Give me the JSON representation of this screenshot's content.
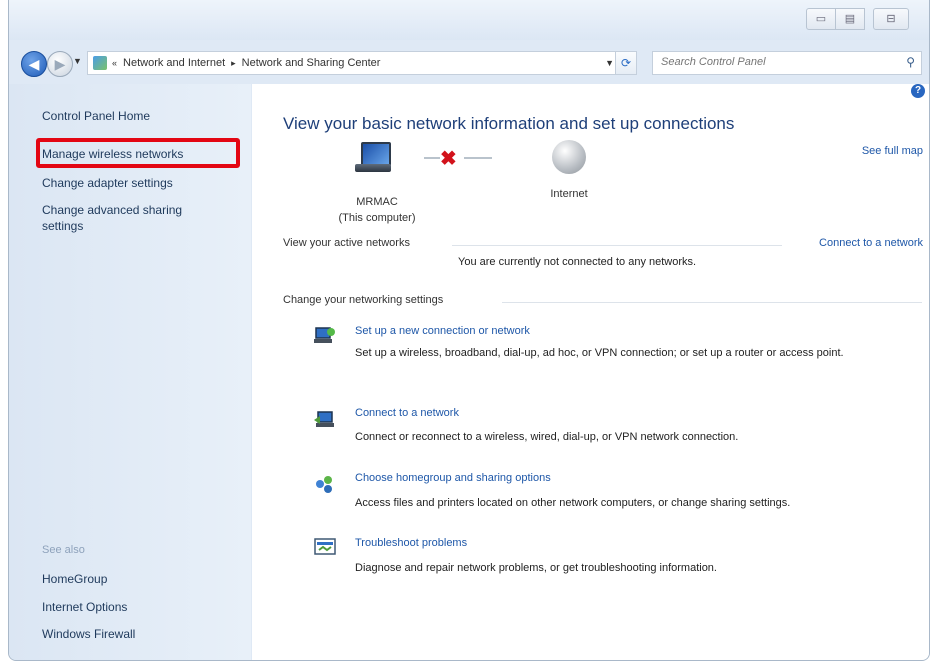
{
  "window": {
    "buttons": [
      "▭",
      "▤",
      "⊟"
    ]
  },
  "nav": {
    "back": "◀",
    "forward": "▶",
    "breadcrumbs": [
      "Network and Internet",
      "Network and Sharing Center"
    ],
    "crumb_sep_lead": "«",
    "crumb_sep": "▸",
    "search_placeholder": "Search Control Panel"
  },
  "sidebar": {
    "home": "Control Panel Home",
    "links": [
      "Manage wireless networks",
      "Change adapter settings",
      "Change advanced sharing settings"
    ],
    "see_also_title": "See also",
    "see_also": [
      "HomeGroup",
      "Internet Options",
      "Windows Firewall"
    ]
  },
  "main": {
    "help": "?",
    "title": "View your basic network information and set up connections",
    "see_full_map": "See full map",
    "computer_name": "MRMAC",
    "computer_sub": "(This computer)",
    "internet_label": "Internet",
    "x_mark": "✖",
    "active_networks_label": "View your active networks",
    "connect_link": "Connect to a network",
    "not_connected": "You are currently not connected to any networks.",
    "change_settings_label": "Change your networking settings",
    "tasks": [
      {
        "title": "Set up a new connection or network",
        "desc": "Set up a wireless, broadband, dial-up, ad hoc, or VPN connection; or set up a router or access point."
      },
      {
        "title": "Connect to a network",
        "desc": "Connect or reconnect to a wireless, wired, dial-up, or VPN network connection."
      },
      {
        "title": "Choose homegroup and sharing options",
        "desc": "Access files and printers located on other network computers, or change sharing settings."
      },
      {
        "title": "Troubleshoot problems",
        "desc": "Diagnose and repair network problems, or get troubleshooting information."
      }
    ]
  },
  "colors": {
    "link": "#1e57a8",
    "highlight": "#e30613",
    "title": "#1e3f79"
  }
}
